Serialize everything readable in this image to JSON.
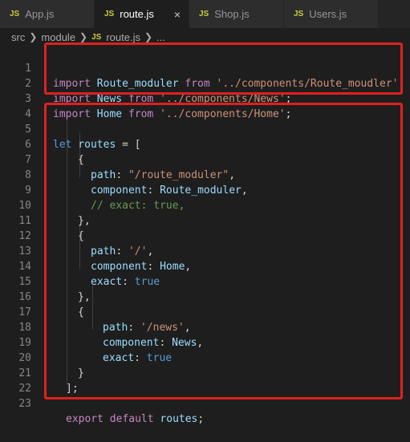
{
  "tabs": [
    {
      "label": "App.js",
      "icon": "JS"
    },
    {
      "label": "route.js",
      "icon": "JS",
      "active": true
    },
    {
      "label": "Shop.js",
      "icon": "JS"
    },
    {
      "label": "Users.js",
      "icon": "JS"
    }
  ],
  "close_glyph": "×",
  "breadcrumb": {
    "folder1": "src",
    "folder2": "module",
    "icon": "JS",
    "file": "route.js",
    "ellipsis": "..."
  },
  "colors": {
    "highlight": "#e02020",
    "js_icon": "#cbcb41",
    "keyword": "#c586c0",
    "string": "#ce9178",
    "variable": "#9cdcfe"
  },
  "code": {
    "line_numbers": [
      "1",
      "2",
      "3",
      "4",
      "5",
      "6",
      "7",
      "8",
      "9",
      "10",
      "11",
      "12",
      "13",
      "14",
      "15",
      "16",
      "17",
      "18",
      "19",
      "20",
      "21",
      "22",
      "23"
    ],
    "l1": {
      "kw": "import",
      "name": " Route_moduler ",
      "from": "from",
      "path": " '../components/Route_moudler'",
      "end": ";"
    },
    "l2": {
      "kw": "import",
      "name": " News ",
      "from": "from",
      "path": " '../components/News'",
      "end": ";"
    },
    "l3": {
      "kw": "import",
      "name": " Home ",
      "from": "from",
      "path": " '../components/Home'",
      "end": ";"
    },
    "l5": {
      "kw": "let",
      "name": " routes",
      "rest": " = ["
    },
    "l6": "{",
    "l7": {
      "key": "path",
      "colon": ": ",
      "val": "\"/route_moduler\"",
      "end": ","
    },
    "l8": {
      "key": "component",
      "colon": ": ",
      "val": "Route_moduler",
      "end": ","
    },
    "l9": "// exact: true,",
    "l10": "},",
    "l11": "{",
    "l12": {
      "key": "path",
      "colon": ": ",
      "val": "'/'",
      "end": ","
    },
    "l13": {
      "key": "component",
      "colon": ": ",
      "val": "Home",
      "end": ","
    },
    "l14": {
      "key": "exact",
      "colon": ": ",
      "val": "true"
    },
    "l15": "},",
    "l16": "{",
    "l17": {
      "key": "path",
      "colon": ": ",
      "val": "'/news'",
      "end": ","
    },
    "l18": {
      "key": "component",
      "colon": ": ",
      "val": "News",
      "end": ","
    },
    "l19": {
      "key": "exact",
      "colon": ": ",
      "val": "true"
    },
    "l20": "}",
    "l21": "];",
    "l23": {
      "kw1": "export",
      "kw2": " default",
      "name": " routes",
      "end": ";"
    }
  }
}
